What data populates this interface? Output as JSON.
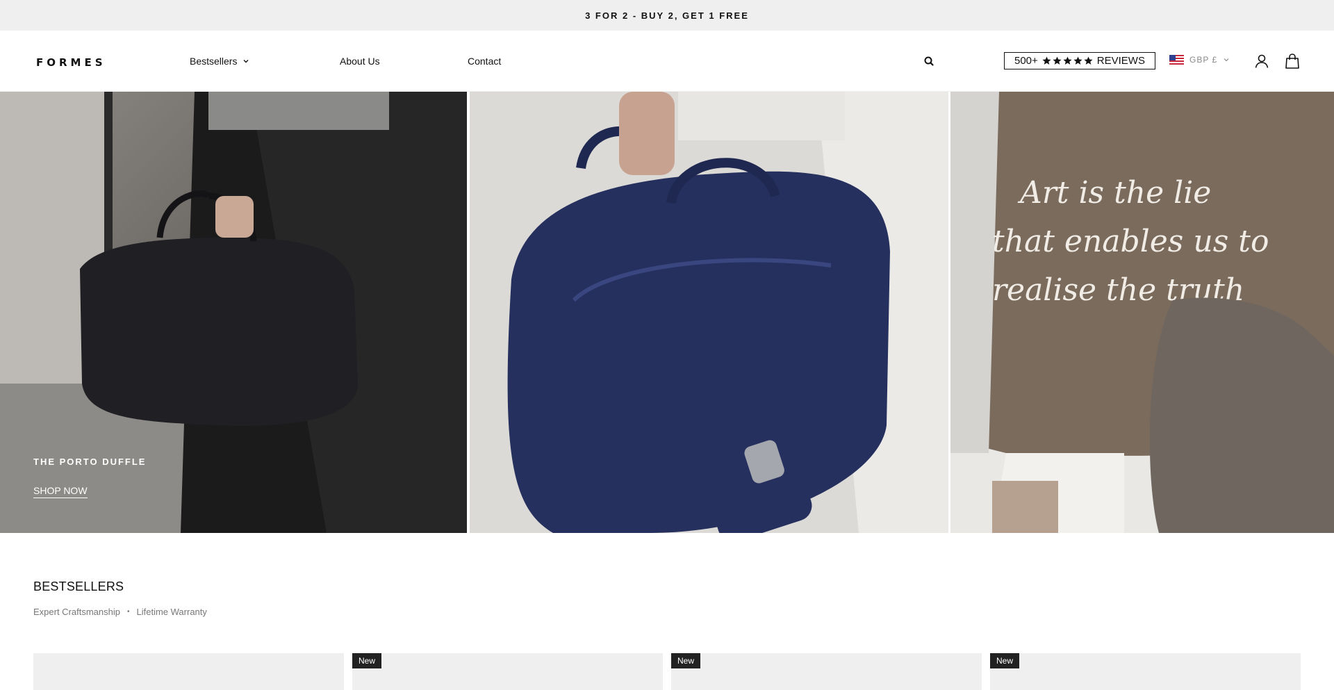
{
  "announcement": {
    "text": "3 FOR 2 - BUY 2, GET 1 FREE"
  },
  "header": {
    "logo": "FORMES",
    "nav": [
      {
        "label": "Bestsellers",
        "has_dropdown": true
      },
      {
        "label": "About Us"
      },
      {
        "label": "Contact"
      }
    ],
    "reviews": {
      "count": "500+",
      "stars": 5,
      "label": "REVIEWS"
    },
    "currency": "GBP £"
  },
  "hero": {
    "title": "THE PORTO DUFFLE",
    "cta": "SHOP NOW"
  },
  "bestsellers": {
    "title": "BESTSELLERS",
    "features": [
      "Expert Craftsmanship",
      "Lifetime Warranty"
    ],
    "separator": "•",
    "cards": [
      {
        "badge": ""
      },
      {
        "badge": "New"
      },
      {
        "badge": "New"
      },
      {
        "badge": "New"
      }
    ]
  },
  "colors": {
    "announce_bg": "#efefef",
    "text": "#111111",
    "badge_bg": "#222222"
  }
}
